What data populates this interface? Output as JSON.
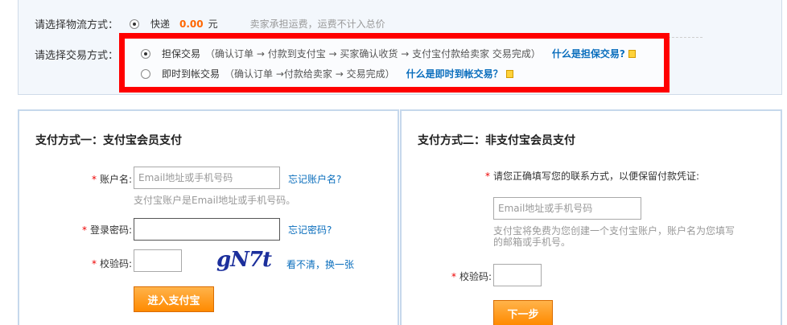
{
  "logistics": {
    "label": "请选择物流方式：",
    "option": "快递",
    "price": "0.00",
    "unit": "元",
    "note": "卖家承担运费，运费不计入总价"
  },
  "trade": {
    "label": "请选择交易方式：",
    "options": [
      {
        "name": "担保交易",
        "flow": "（确认订单 → 付款到支付宝 → 买家确认收货 → 支付宝付款给卖家 交易完成）",
        "link": "什么是担保交易?"
      },
      {
        "name": "即时到帐交易",
        "flow": "（确认订单 →付款给卖家 → 交易完成）",
        "link": "什么是即时到帐交易？"
      }
    ]
  },
  "panel_left": {
    "title": "支付方式一：支付宝会员支付",
    "account_label": "账户名:",
    "account_placeholder": "Email地址或手机号码",
    "forgot_account": "忘记账户名?",
    "account_hint": "支付宝账户是Email地址或手机号码。",
    "password_label": "登录密码:",
    "forgot_password": "忘记密码?",
    "captcha_label": "校验码:",
    "captcha_text": "gN7t",
    "refresh_captcha": "看不清，换一张",
    "submit": "进入支付宝"
  },
  "panel_right": {
    "title": "支付方式二：非支付宝会员支付",
    "contact_prompt": "请您正确填写您的联系方式，以便保留付款凭证:",
    "contact_placeholder": "Email地址或手机号码",
    "contact_hint": "支付宝将免费为您创建一个支付宝账户，账户名为您填写的邮箱或手机号。",
    "captcha_label": "校验码:",
    "next": "下一步"
  }
}
